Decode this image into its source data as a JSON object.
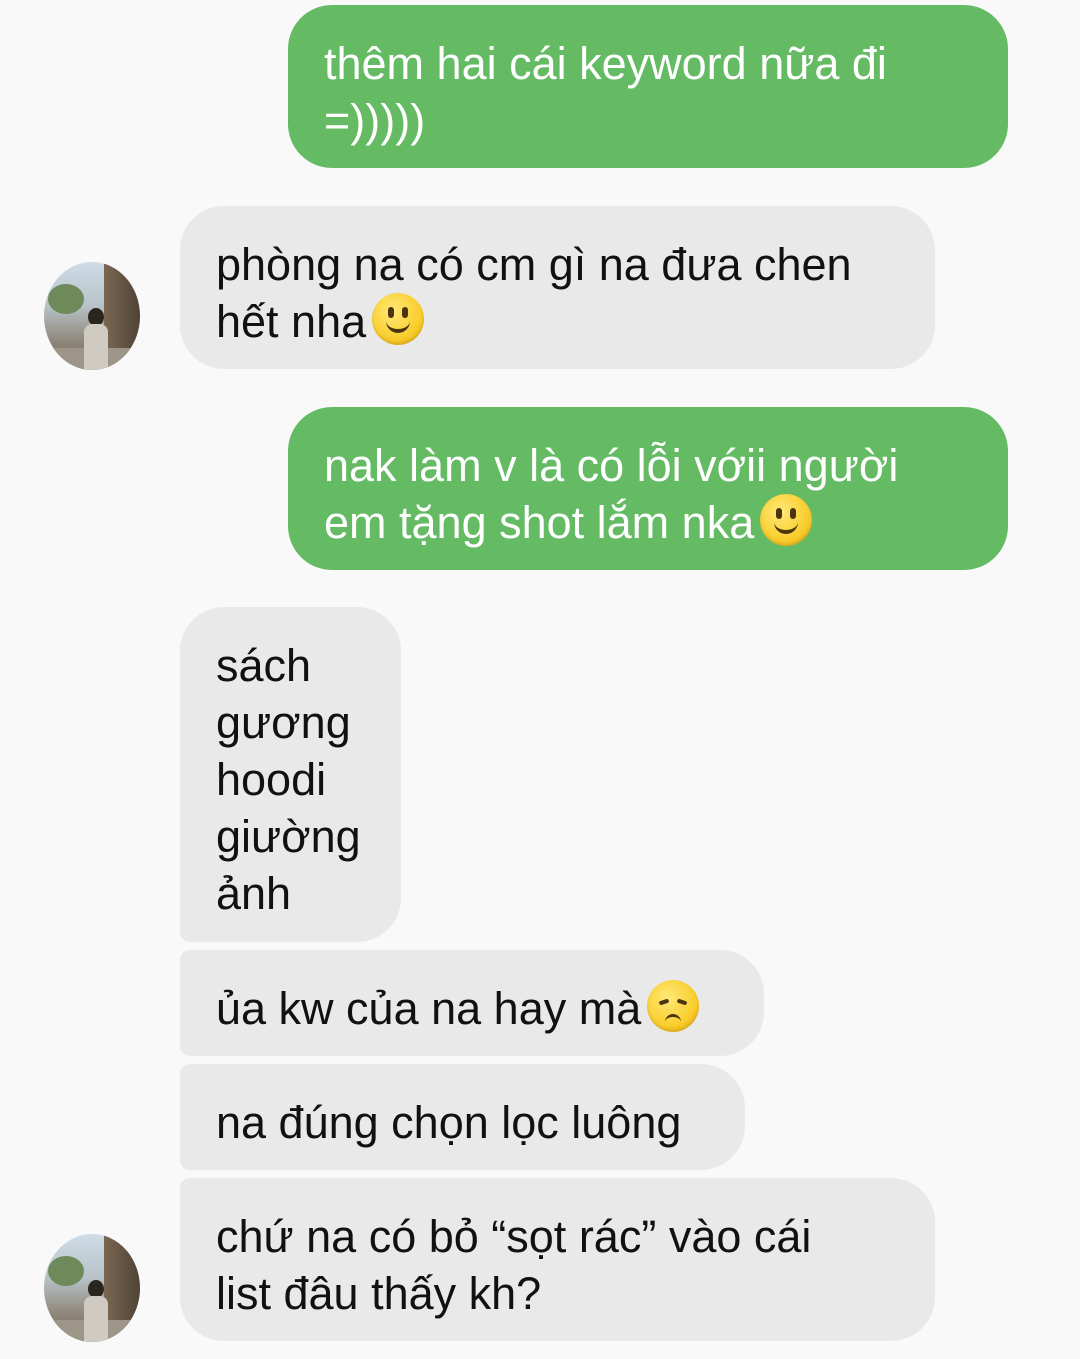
{
  "messages": [
    {
      "from": "me",
      "lines": [
        "thêm hai cái keyword nữa đi",
        "=)))))"
      ]
    },
    {
      "from": "them",
      "lines": [
        "phòng na có cm gì na đưa chen",
        "hết nha"
      ],
      "emoji": "slightly-smiling-face-icon"
    },
    {
      "from": "me",
      "lines": [
        "nak làm v là có lỗi vớii người",
        "em tặng shot lắm nka"
      ],
      "emoji": "slightly-smiling-face-icon"
    },
    {
      "from": "them",
      "lines": [
        "sách",
        "gương",
        "hoodi",
        "giường",
        "ảnh"
      ]
    },
    {
      "from": "them",
      "lines": [
        "ủa kw của na hay mà"
      ],
      "emoji": "pensive-face-icon"
    },
    {
      "from": "them",
      "lines": [
        "na đúng chọn lọc luông"
      ]
    },
    {
      "from": "them",
      "lines": [
        "chứ na có bỏ “sọt rác” vào cái",
        "list đâu thấy kh?"
      ]
    }
  ],
  "colors": {
    "sent_bubble": "#64bb64",
    "received_bubble": "#e9e9e9",
    "background": "#f9f9f9"
  }
}
